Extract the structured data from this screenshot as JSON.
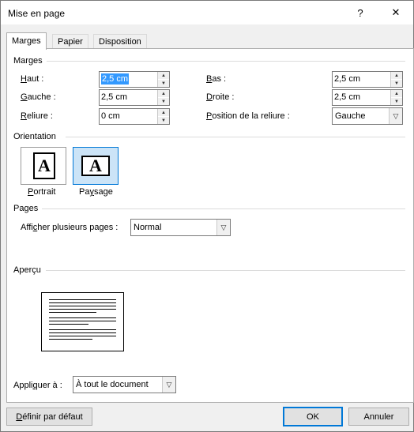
{
  "window": {
    "title": "Mise en page",
    "help": "?",
    "close": "✕"
  },
  "tabs": [
    "Marges",
    "Papier",
    "Disposition"
  ],
  "margins": {
    "group": "Marges",
    "top": {
      "label_pre": "",
      "label_key": "H",
      "label_post": "aut :",
      "value": "2,5 cm"
    },
    "bottom": {
      "label_pre": "",
      "label_key": "B",
      "label_post": "as :",
      "value": "2,5 cm"
    },
    "left": {
      "label_pre": "",
      "label_key": "G",
      "label_post": "auche :",
      "value": "2,5 cm"
    },
    "right": {
      "label_pre": "",
      "label_key": "D",
      "label_post": "roite :",
      "value": "2,5 cm"
    },
    "gutter": {
      "label_pre": "",
      "label_key": "R",
      "label_post": "eliure :",
      "value": "0 cm"
    },
    "gutter_pos": {
      "label_pre": "",
      "label_key": "P",
      "label_post": "osition de la reliure :",
      "value": "Gauche"
    }
  },
  "orientation": {
    "group": "Orientation",
    "portrait": {
      "label_pre": "",
      "label_key": "P",
      "label_post": "ortrait",
      "glyph": "A"
    },
    "landscape": {
      "label_pre": "Pa",
      "label_key": "y",
      "label_post": "sage",
      "glyph": "A"
    }
  },
  "pages": {
    "group": "Pages",
    "multiple": {
      "label_pre": "Affi",
      "label_key": "c",
      "label_post": "her plusieurs pages :",
      "value": "Normal"
    }
  },
  "preview": {
    "group": "Aperçu"
  },
  "apply": {
    "label_pre": "Appli",
    "label_key": "q",
    "label_post": "uer à :",
    "value": "À tout le document"
  },
  "buttons": {
    "set_default": {
      "label_pre": "",
      "label_key": "D",
      "label_post": "éfinir par défaut"
    },
    "ok": "OK",
    "cancel": "Annuler"
  },
  "colors": {
    "accent": "#0078d7",
    "selection": "#3399ff",
    "dialog_bg": "#f0f0f0"
  }
}
